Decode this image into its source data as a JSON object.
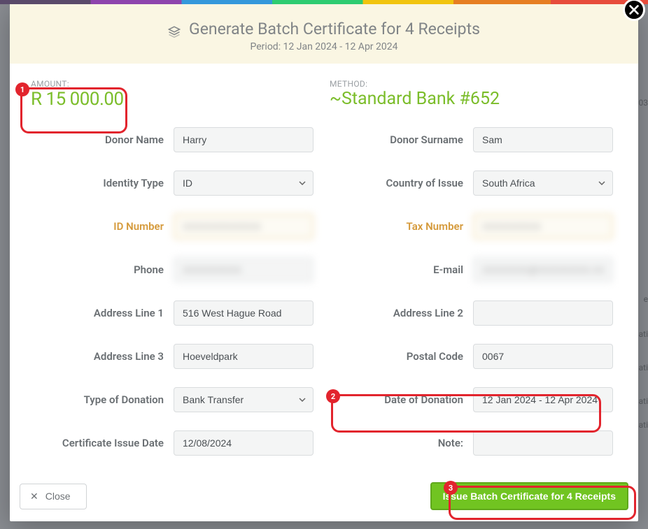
{
  "header": {
    "title": "Generate Batch Certificate for 4 Receipts",
    "period_label": "Period: 12 Jan 2024 - 12 Apr 2024"
  },
  "summary": {
    "amount_label": "AMOUNT:",
    "amount_value": "R 15 000.00",
    "method_label": "METHOD:",
    "method_value": "~Standard Bank #652"
  },
  "callouts": {
    "one": "1",
    "two": "2",
    "three": "3"
  },
  "form": {
    "donor_name": {
      "label": "Donor Name",
      "value": "Harry"
    },
    "donor_surname": {
      "label": "Donor Surname",
      "value": "Sam"
    },
    "identity_type": {
      "label": "Identity Type",
      "selected": "ID"
    },
    "country_of_issue": {
      "label": "Country of Issue",
      "selected": "South Africa"
    },
    "id_number": {
      "label": "ID Number",
      "value": "XXXXXXXXXXXX"
    },
    "tax_number": {
      "label": "Tax Number",
      "value": "XXXXXXXXX"
    },
    "phone": {
      "label": "Phone",
      "value": "XXXXXXXXX"
    },
    "email": {
      "label": "E-mail",
      "value": "XXXXXXX@XXXXXXXX.XX.XX"
    },
    "address1": {
      "label": "Address Line 1",
      "value": "516 West Hague Road"
    },
    "address2": {
      "label": "Address Line 2",
      "value": ""
    },
    "address3": {
      "label": "Address Line 3",
      "value": "Hoeveldpark"
    },
    "postal_code": {
      "label": "Postal Code",
      "value": "0067"
    },
    "donation_type": {
      "label": "Type of Donation",
      "selected": "Bank Transfer"
    },
    "donation_date": {
      "label": "Date of Donation",
      "value": "12 Jan 2024 - 12 Apr 2024"
    },
    "cert_issue_date": {
      "label": "Certificate Issue Date",
      "value": "12/08/2024"
    },
    "note": {
      "label": "Note:",
      "value": ""
    }
  },
  "footer": {
    "close_label": "Close",
    "issue_label": "Issue Batch Certificate for 4 Receipts"
  },
  "bg_hints": {
    "h1": "03",
    "h2": "e",
    "h3": "ati",
    "h4": "ati",
    "h5": "ati",
    "h6": "ati"
  }
}
